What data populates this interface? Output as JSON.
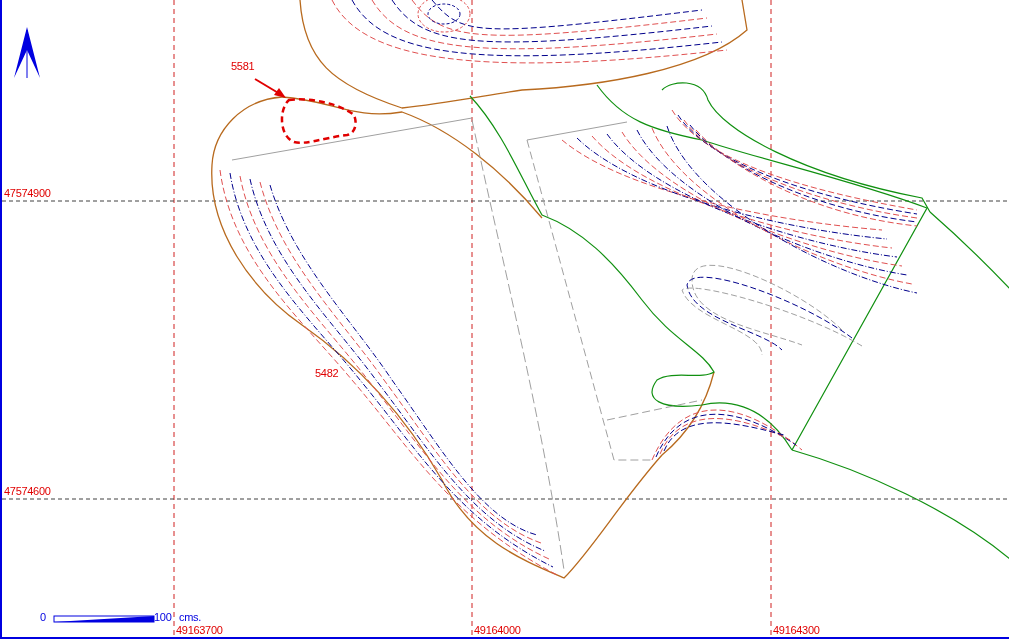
{
  "grid": {
    "northings": [
      "47574900",
      "47574600"
    ],
    "eastings": [
      "49163700",
      "49164000",
      "49164300"
    ]
  },
  "features": [
    {
      "label": "5581",
      "highlighted": true
    },
    {
      "label": "5482",
      "highlighted": false
    }
  ],
  "scale_bar": {
    "start": "0",
    "end": "100",
    "unit": "cms."
  }
}
